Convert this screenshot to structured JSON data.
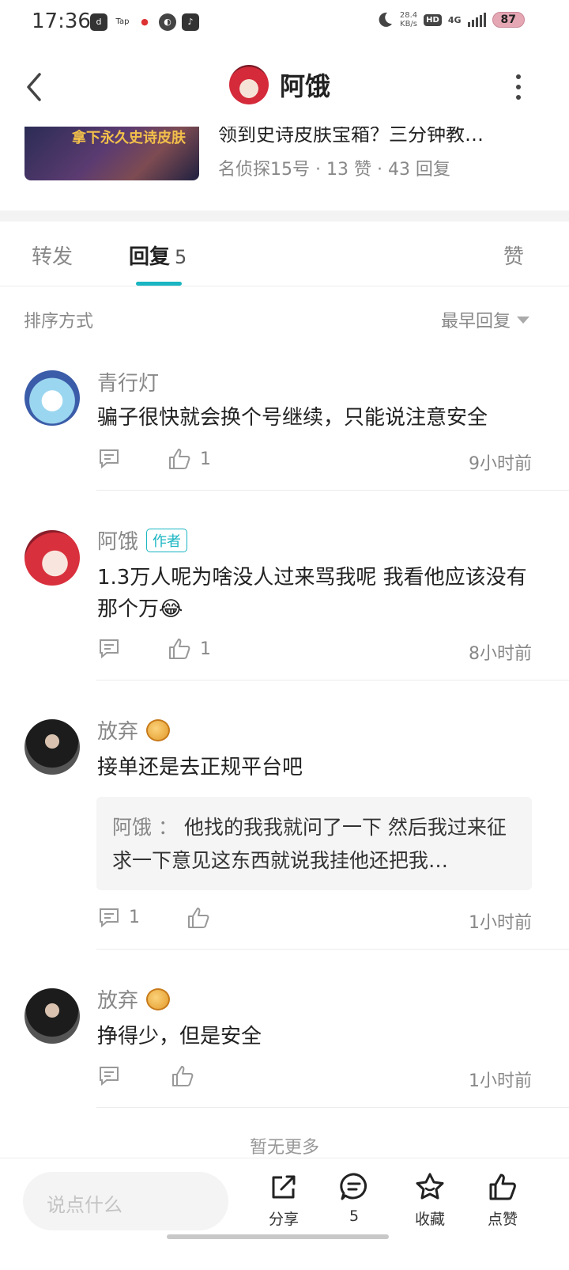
{
  "status_bar": {
    "time": "17:36",
    "apps": [
      "d",
      "Tap",
      "●",
      "◐",
      "♪"
    ],
    "net_speed_value": "28.4",
    "net_speed_unit": "KB/s",
    "hd": "HD",
    "network": "4G",
    "battery": "87"
  },
  "header": {
    "title": "阿饿"
  },
  "post": {
    "thumb_text": "拿下永久史诗皮肤",
    "title": "领到史诗皮肤宝箱？三分钟教…",
    "meta": "名侦探15号 · 13 赞 · 43 回复"
  },
  "tabs": {
    "forward": "转发",
    "reply": "回复",
    "reply_count": "5",
    "like": "赞"
  },
  "sort": {
    "label": "排序方式",
    "value": "最早回复"
  },
  "comments": [
    {
      "name": "青行灯",
      "text": "骗子很快就会换个号继续，只能说注意安全",
      "reply_count": "",
      "like_count": "1",
      "time": "9小时前"
    },
    {
      "name": "阿饿",
      "badge": "作者",
      "text": "1.3万人呢为啥没人过来骂我呢  我看他应该没有那个万😂",
      "reply_count": "",
      "like_count": "1",
      "time": "8小时前"
    },
    {
      "name": "放弃",
      "text": "接单还是去正规平台吧",
      "quote_author": "阿饿",
      "quote_sep": "：",
      "quote_text": "他找的我我就问了一下  然后我过来征求一下意见这东西就说我挂他还把我…",
      "reply_count": "1",
      "like_count": "",
      "time": "1小时前"
    },
    {
      "name": "放弃",
      "text": "挣得少，但是安全",
      "reply_count": "",
      "like_count": "",
      "time": "1小时前"
    }
  ],
  "footer_note": "暂无更多",
  "bottom_bar": {
    "input_placeholder": "说点什么",
    "share": "分享",
    "comment_count": "5",
    "favorite": "收藏",
    "like": "点赞"
  },
  "colors": {
    "accent": "#1ab5c2",
    "muted_text": "#888888"
  }
}
